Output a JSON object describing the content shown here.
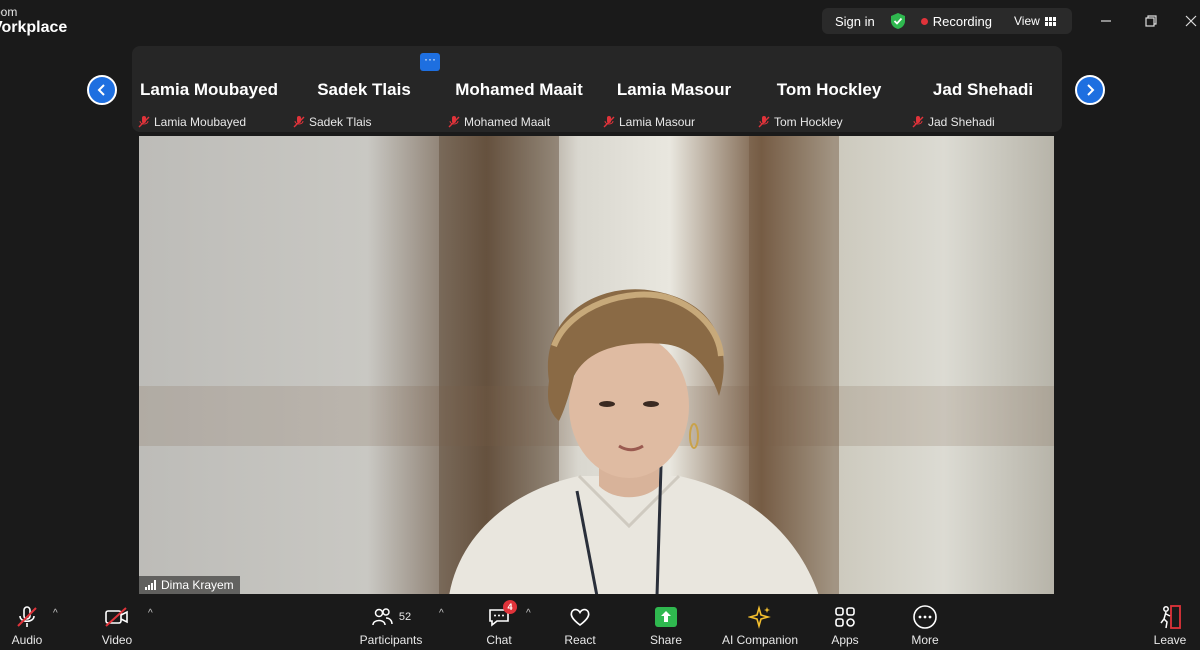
{
  "app": {
    "title_line1": "oom",
    "title_line2": "Vorkplace"
  },
  "header": {
    "sign_in": "Sign in",
    "recording": "Recording",
    "view": "View"
  },
  "participants_strip": {
    "more_label": "···",
    "tiles": [
      {
        "name": "Lamia Moubayed",
        "label": "Lamia Moubayed"
      },
      {
        "name": "Sadek Tlais",
        "label": "Sadek Tlais"
      },
      {
        "name": "Mohamed Maait",
        "label": "Mohamed Maait"
      },
      {
        "name": "Lamia Masour",
        "label": "Lamia Masour"
      },
      {
        "name": "Tom Hockley",
        "label": "Tom Hockley"
      },
      {
        "name": "Jad Shehadi",
        "label": "Jad Shehadi"
      }
    ]
  },
  "active_speaker": {
    "name": "Dima Krayem"
  },
  "toolbar": {
    "audio": "Audio",
    "video": "Video",
    "participants": "Participants",
    "participants_count": "52",
    "chat": "Chat",
    "chat_badge": "4",
    "react": "React",
    "share": "Share",
    "ai_companion": "AI Companion",
    "apps": "Apps",
    "more": "More",
    "leave": "Leave"
  },
  "colors": {
    "accent": "#1e6fe0",
    "recording": "#e0333a",
    "shield": "#2fb84f",
    "share": "#2fb84f",
    "ai": "#f5c02e",
    "leave": "#e0333a"
  }
}
